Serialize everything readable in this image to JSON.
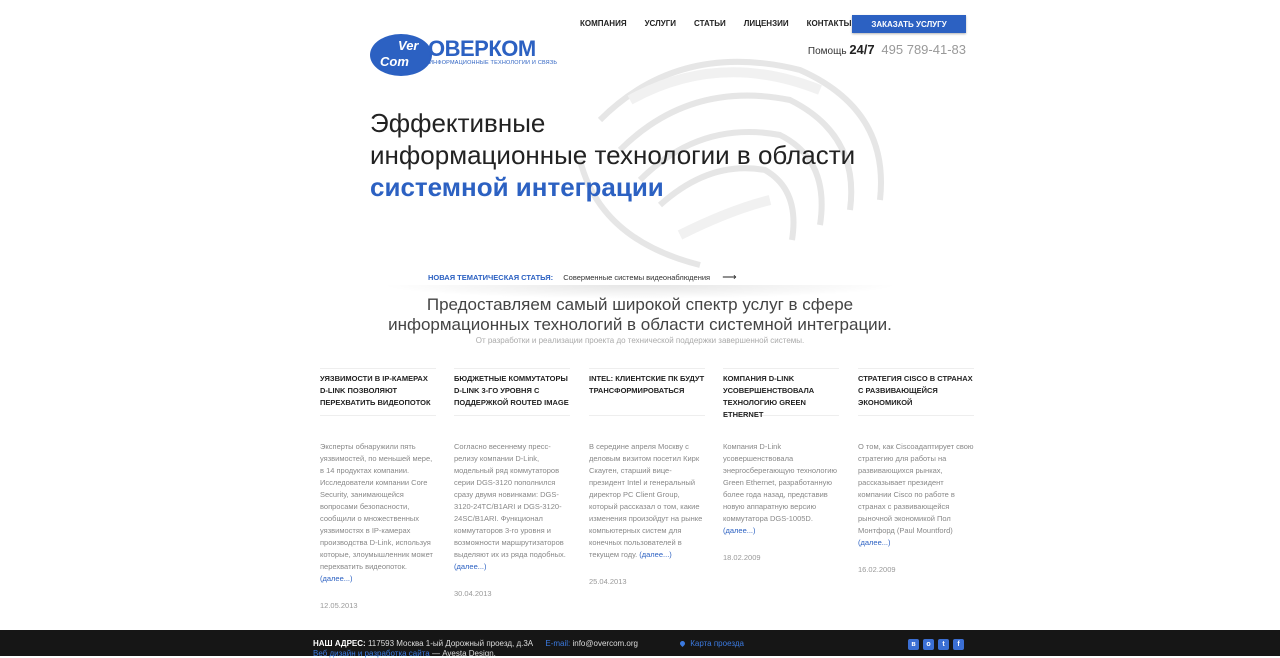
{
  "header": {
    "logo": {
      "badge_top": "Ver",
      "badge_bottom": "Com",
      "name": "ОВЕРКОМ",
      "tagline": "ИНФОРМАЦИОННЫЕ ТЕХНОЛОГИИ И СВЯЗЬ"
    },
    "nav": [
      "КОМПАНИЯ",
      "УСЛУГИ",
      "СТАТЬИ",
      "ЛИЦЕНЗИИ",
      "КОНТАКТЫ"
    ],
    "order_button": "ЗАКАЗАТЬ УСЛУГУ",
    "help_label": "Помощь",
    "help_hours": "24/7",
    "phone": "495 789-41-83"
  },
  "hero": {
    "line1": "Эффективные",
    "line2": "информационные технологии в области",
    "line3": "системной интеграции"
  },
  "new_article": {
    "label": "НОВАЯ ТЕМАТИЧЕСКАЯ СТАТЬЯ:",
    "title": "Соверменные системы видеонаблюдения",
    "arrow": "⟶"
  },
  "lead": {
    "line1": "Предоставляем самый широкой спектр услуг в сфере",
    "line2": "информационных технологий в области системной интеграции.",
    "sub": "От разработки и реализации проекта до технической поддержки завершенной системы."
  },
  "news": [
    {
      "title": "УЯЗВИМОСТИ В IP-КАМЕРАХ D-LINK ПОЗВОЛЯЮТ ПЕРЕХВАТИТЬ ВИДЕОПОТОК",
      "body": "Эксперты обнаружили пять уязвимостей, по меньшей мере, в 14 продуктах компании. Исследователи компании Core Security, занимающейся вопросами безопасности, сообщили о множественных уязвимостях в IP-камерах производства D-Link, используя которые, злоумышленник может перехватить видеопоток.",
      "more": "(далее...)",
      "date": "12.05.2013"
    },
    {
      "title": "БЮДЖЕТНЫЕ КОММУТАТОРЫ D-LINK 3-ГО УРОВНЯ С ПОДДЕРЖКОЙ ROUTED IMAGE",
      "body": "Согласно весеннему пресс-релизу компании D-Link, модельный ряд коммутаторов серии DGS-3120 пополнился сразу двумя новинками: DGS-3120-24TC/B1ARI и DGS-3120-24SC/B1ARI. Функционал коммутаторов 3-го уровня и возможности маршрутизаторов выделяют их из ряда подобных.",
      "more": "(далее...)",
      "date": "30.04.2013"
    },
    {
      "title": "INTEL: КЛИЕНТСКИЕ ПК БУДУТ ТРАНСФОРМИРОВАТЬСЯ",
      "body": "В середине апреля Москву с деловым визитом посетил Кирк Скауген, старший вице-президент Intel и генеральный директор PC Client Group, который рассказал о том, какие изменения произойдут на рынке компьютерных систем для конечных пользователей в текущем году.",
      "more": "(далее...)",
      "date": "25.04.2013"
    },
    {
      "title": "КОМПАНИЯ D-LINK УСОВЕРШЕНСТВОВАЛА ТЕХНОЛОГИЮ GREEN ETHERNET",
      "body": "Компания D-Link усовершенствовала энергосберегающую технологию Green Ethernet, разработанную более года назад, представив новую аппаратную версию коммутатора DGS-1005D.",
      "more": "(далее...)",
      "date": "18.02.2009"
    },
    {
      "title": "СТРАТЕГИЯ CISCO В СТРАНАХ С РАЗВИВАЮЩЕЙСЯ ЭКОНОМИКОЙ",
      "body": "О том, как Ciscoадаптирует свою стратегию для работы на развивающихся рынках, рассказывает президент компании Cisco по работе в странах с развивающейся рыночной экономикой Пол Монтфорд (Paul Mountford)",
      "more": "(далее...)",
      "date": "16.02.2009"
    }
  ],
  "footer": {
    "address_label": "НАШ АДРЕС:",
    "address": "117593 Москва  1-ый Дорожный проезд, д.3А",
    "email_label": "E-mail:",
    "email": "info@overcom.org",
    "map_link": "Карта проезда",
    "dev_link": "Веб дизайн и разработка сайта",
    "dev_by": "— Avesta Design."
  }
}
